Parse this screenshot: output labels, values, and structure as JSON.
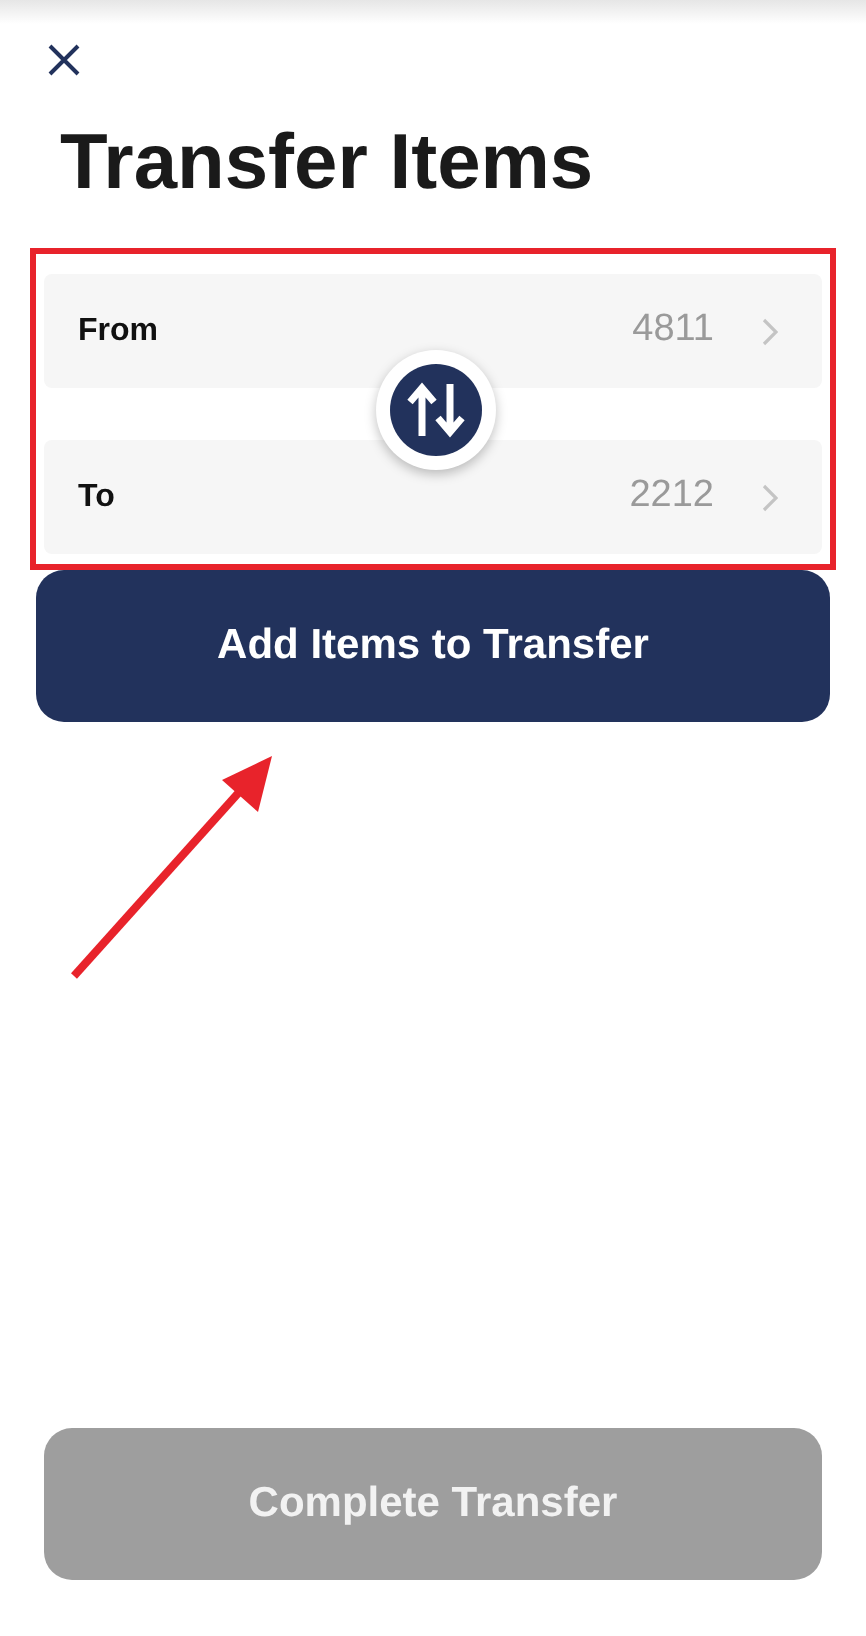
{
  "title": "Transfer Items",
  "locations": [
    {
      "label": "From",
      "value": "4811"
    },
    {
      "label": "To",
      "value": "2212"
    }
  ],
  "add_button": {
    "label": "Add Items to Transfer"
  },
  "complete_button": {
    "label": "Complete Transfer",
    "disabled": true
  }
}
